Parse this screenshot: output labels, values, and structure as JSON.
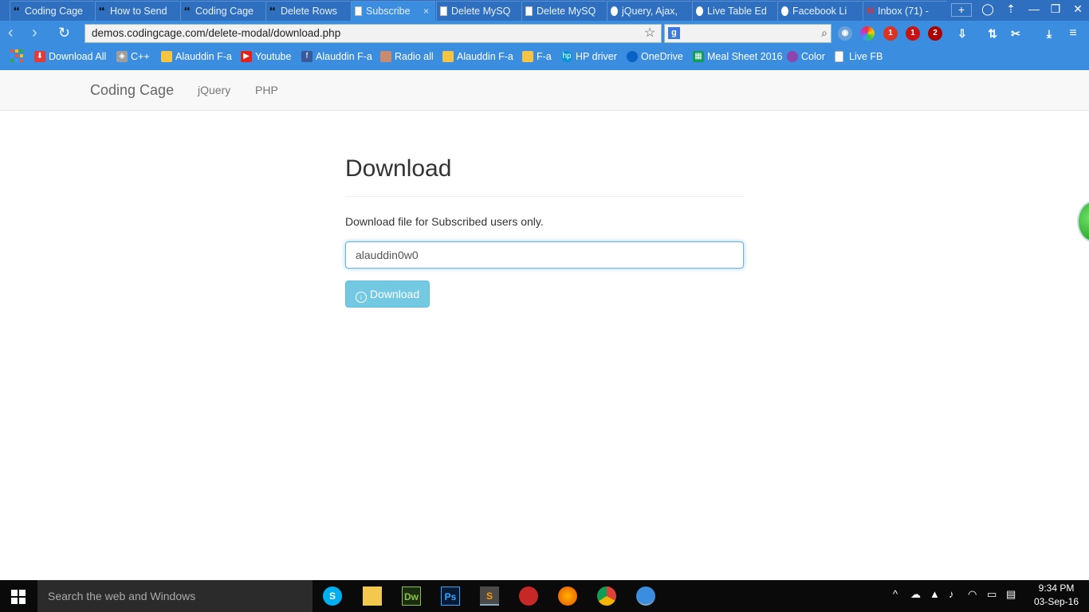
{
  "browser": {
    "tabs": [
      {
        "label": "Coding Cage",
        "icon": "codingcage-icon",
        "active": false
      },
      {
        "label": "How to Send",
        "icon": "codingcage-icon",
        "active": false
      },
      {
        "label": "Coding Cage",
        "icon": "codingcage-icon",
        "active": false
      },
      {
        "label": "Delete Rows",
        "icon": "codingcage-icon",
        "active": false
      },
      {
        "label": "Subscribe",
        "icon": "document-icon",
        "active": true
      },
      {
        "label": "Delete MySQ",
        "icon": "document-icon",
        "active": false
      },
      {
        "label": "Delete MySQ",
        "icon": "document-icon",
        "active": false
      },
      {
        "label": "jQuery, Ajax,",
        "icon": "drop-icon",
        "active": false
      },
      {
        "label": "Live Table Ed",
        "icon": "drop-icon",
        "active": false
      },
      {
        "label": "Facebook Li",
        "icon": "drop-icon",
        "active": false
      },
      {
        "label": "Inbox (71) -",
        "icon": "gmail-icon",
        "active": false
      }
    ],
    "tab_close": "×",
    "new_tab": "+",
    "url": "demos.codingcage.com/delete-modal/download.php",
    "bookmarks": [
      {
        "label": "Download All",
        "icon": "download-all-icon",
        "color": "#e53935"
      },
      {
        "label": "C++",
        "icon": "cpp-icon",
        "color": "#9e9e9e"
      },
      {
        "label": "Alauddin F-a",
        "icon": "folder-icon",
        "color": "#f5c542"
      },
      {
        "label": "Youtube",
        "icon": "youtube-icon",
        "color": "#e62117"
      },
      {
        "label": "Alauddin F-a",
        "icon": "facebook-icon",
        "color": "#3b5998"
      },
      {
        "label": "Radio all",
        "icon": "radio-icon",
        "color": "#c98b6b"
      },
      {
        "label": "Alauddin F-a",
        "icon": "folder-icon",
        "color": "#f5c542"
      },
      {
        "label": "F-a",
        "icon": "folder-icon",
        "color": "#f5c542"
      },
      {
        "label": "HP driver",
        "icon": "hp-icon",
        "color": "#0096d6"
      },
      {
        "label": "OneDrive",
        "icon": "onedrive-icon",
        "color": "#0a62c4"
      },
      {
        "label": "Meal Sheet 2016",
        "icon": "sheets-icon",
        "color": "#0f9d58"
      },
      {
        "label": "Color",
        "icon": "color-icon",
        "color": "#8e44ad"
      },
      {
        "label": "Live FB",
        "icon": "document-icon",
        "color": "#ffffff"
      }
    ],
    "extension_badges": [
      "1",
      "1",
      "2"
    ]
  },
  "site": {
    "brand": "Coding Cage",
    "nav": [
      "jQuery",
      "PHP"
    ]
  },
  "page": {
    "title": "Download",
    "description": "Download file for Subscribed users only.",
    "email_value": "alauddin0w0",
    "button_label": "Download",
    "button_color": "#5bc0de"
  },
  "taskbar": {
    "search_placeholder": "Search the web and Windows",
    "apps": [
      "skype-icon",
      "file-explorer-icon",
      "dreamweaver-icon",
      "photoshop-icon",
      "sublime-icon",
      "app-icon",
      "firefox-icon",
      "chrome-icon",
      "browser-icon"
    ],
    "time": "9:34 PM",
    "date": "03-Sep-16"
  }
}
